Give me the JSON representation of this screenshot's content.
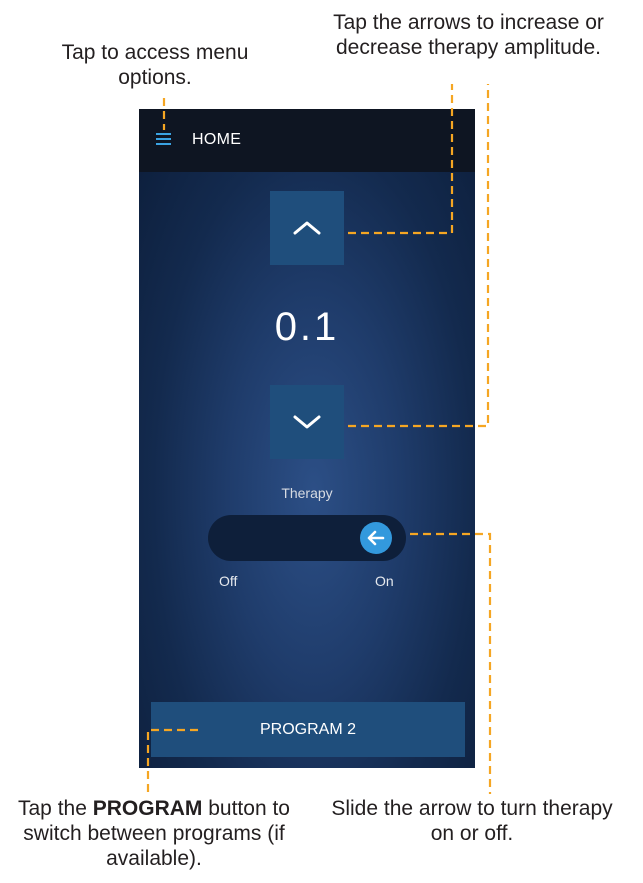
{
  "callouts": {
    "menu": "Tap to access menu options.",
    "arrows": "Tap the arrows to increase or decrease therapy amplitude.",
    "program_prefix": "Tap the ",
    "program_bold": "PROGRAM",
    "program_suffix": " button to switch between programs (if available).",
    "slide": "Slide the arrow to turn therapy on or off."
  },
  "screen": {
    "header": {
      "title": "HOME",
      "menu_icon": "hamburger-icon"
    },
    "amplitude": {
      "value": "0.1",
      "up_icon": "chevron-up-icon",
      "down_icon": "chevron-down-icon"
    },
    "therapy": {
      "label": "Therapy",
      "off_label": "Off",
      "on_label": "On",
      "knob_icon": "arrow-left-icon"
    },
    "program_button": {
      "label": "PROGRAM 2"
    }
  },
  "colors": {
    "accent": "#3399dd",
    "button": "#1f4e7c",
    "header": "#0e1522",
    "leader_line": "#f5a623"
  }
}
